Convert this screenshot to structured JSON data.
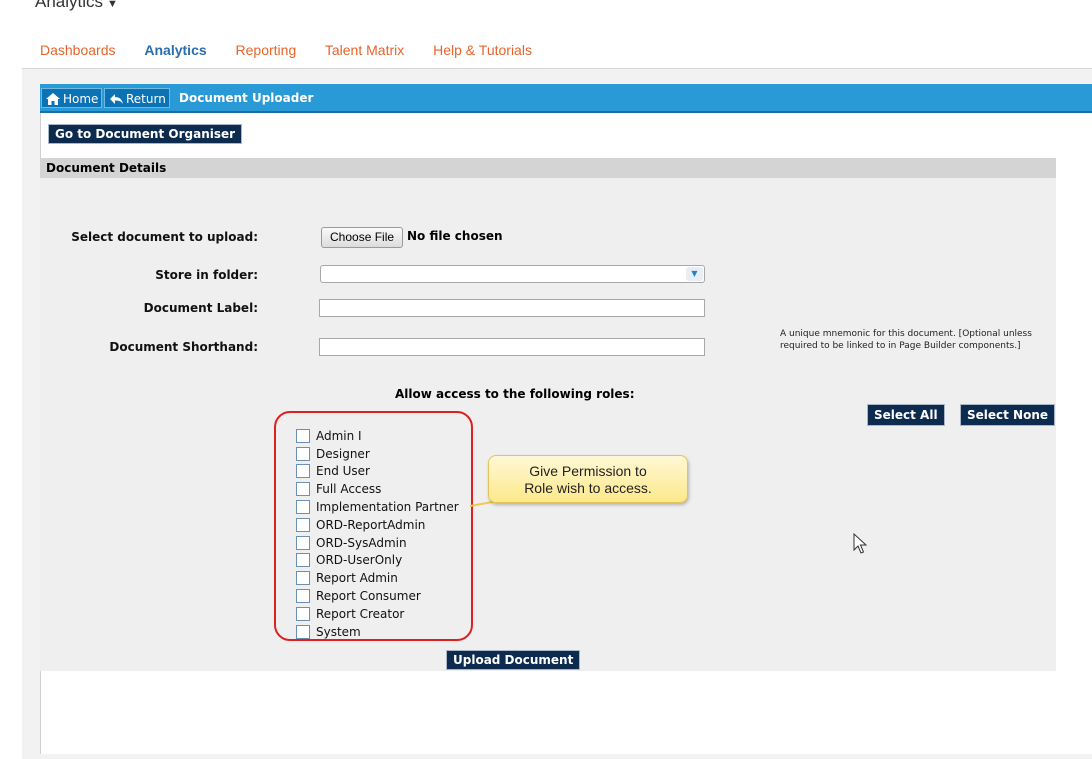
{
  "app": {
    "title": "Analytics"
  },
  "topnav": [
    "Dashboards",
    "Analytics",
    "Reporting",
    "Talent Matrix",
    "Help & Tutorials"
  ],
  "crumbs": {
    "home": "Home",
    "return": "Return",
    "title": "Document Uploader"
  },
  "buttons": {
    "organiser": "Go to Document Organiser",
    "select_all": "Select All",
    "select_none": "Select None",
    "upload": "Upload Document"
  },
  "panel": {
    "title": "Document Details"
  },
  "form": {
    "select_doc_label": "Select document to upload:",
    "choose_file": "Choose File",
    "no_file": "No file chosen",
    "folder_label": "Store in folder:",
    "folder_value": "",
    "doc_label_label": "Document Label:",
    "doc_label_value": "",
    "shorthand_label": "Document Shorthand:",
    "shorthand_value": "",
    "shorthand_hint": "A unique mnemonic for this document. [Optional unless required to be linked to in Page Builder components.]"
  },
  "access_title": "Allow access to the following roles:",
  "roles": [
    "Admin I",
    "Designer",
    "End User",
    "Full Access",
    "Implementation Partner",
    "ORD-ReportAdmin",
    "ORD-SysAdmin",
    "ORD-UserOnly",
    "Report Admin",
    "Report Consumer",
    "Report Creator",
    "System"
  ],
  "callout": {
    "line1": "Give Permission to",
    "line2": "Role wish to access."
  },
  "colors": {
    "nav_orange": "#e8632b",
    "nav_active": "#2a6db0",
    "header_blue": "#2a9ad6",
    "button_navy": "#0d2b4f",
    "annotation_red": "#e02020"
  }
}
